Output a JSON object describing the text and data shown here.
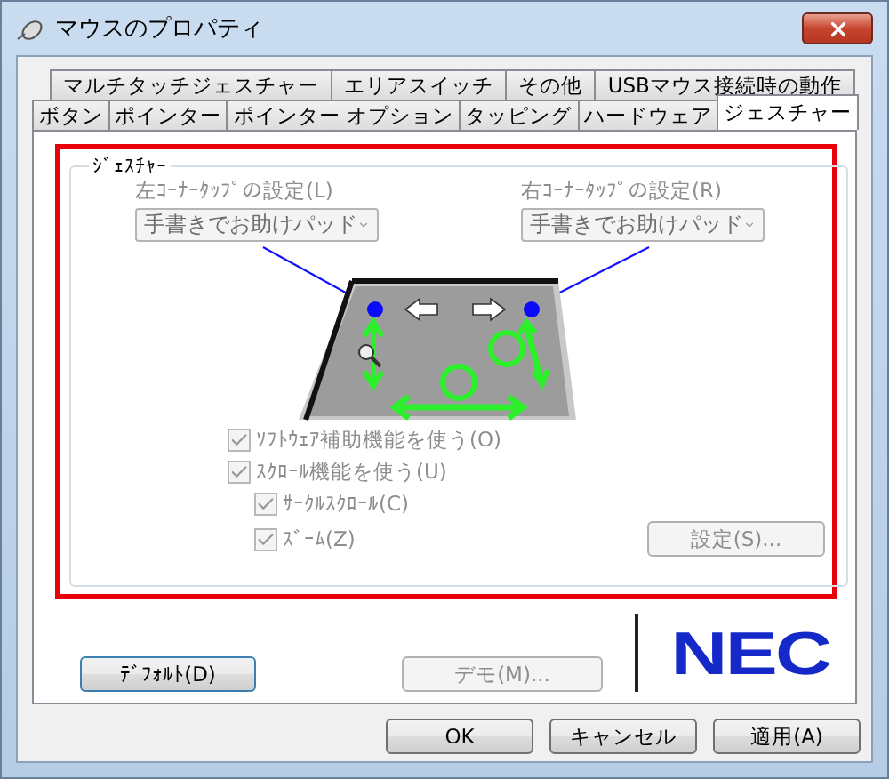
{
  "window": {
    "title": "マウスのプロパティ"
  },
  "tab_rows": [
    [
      {
        "label": "マルチタッチジェスチャー",
        "selected": false
      },
      {
        "label": "エリアスイッチ",
        "selected": false
      },
      {
        "label": "その他",
        "selected": false
      },
      {
        "label": "USBマウス接続時の動作",
        "selected": false
      }
    ],
    [
      {
        "label": "ボタン",
        "selected": false
      },
      {
        "label": "ポインター",
        "selected": false
      },
      {
        "label": "ポインター オプション",
        "selected": false
      },
      {
        "label": "タッピング",
        "selected": false
      },
      {
        "label": "ハードウェア",
        "selected": false
      },
      {
        "label": "ジェスチャー",
        "selected": true
      }
    ]
  ],
  "gesture_group": {
    "label": "ｼﾞｪｽﾁｬｰ",
    "corner_settings": [
      {
        "label": "左ｺｰﾅｰﾀｯﾌﾟの設定(L)",
        "value": "手書きでお助けパッド",
        "disabled": true
      },
      {
        "label": "右ｺｰﾅｰﾀｯﾌﾟの設定(R)",
        "value": "手書きでお助けパッド",
        "disabled": true
      }
    ],
    "options": [
      {
        "label": "ｿﾌﾄｳｪｱ補助機能を使う(O)",
        "checked": true,
        "disabled": true
      },
      {
        "label": "ｽｸﾛｰﾙ機能を使う(U)",
        "checked": true,
        "disabled": true,
        "children": [
          {
            "label": "ｻｰｸﾙｽｸﾛｰﾙ(C)",
            "checked": true,
            "disabled": true
          },
          {
            "label": "ｽﾞｰﾑ(Z)",
            "checked": true,
            "disabled": true
          }
        ]
      }
    ],
    "settings_button": {
      "label": "設定(S)...",
      "disabled": true
    }
  },
  "default_button": {
    "label": "ﾃﾞﾌｫﾙﾄ(D)",
    "disabled": false
  },
  "demo_button": {
    "label": "デモ(M)...",
    "disabled": true
  },
  "logo": "NEC",
  "buttons": [
    {
      "label": "OK"
    },
    {
      "label": "キャンセル"
    },
    {
      "label": "適用(A)"
    }
  ]
}
